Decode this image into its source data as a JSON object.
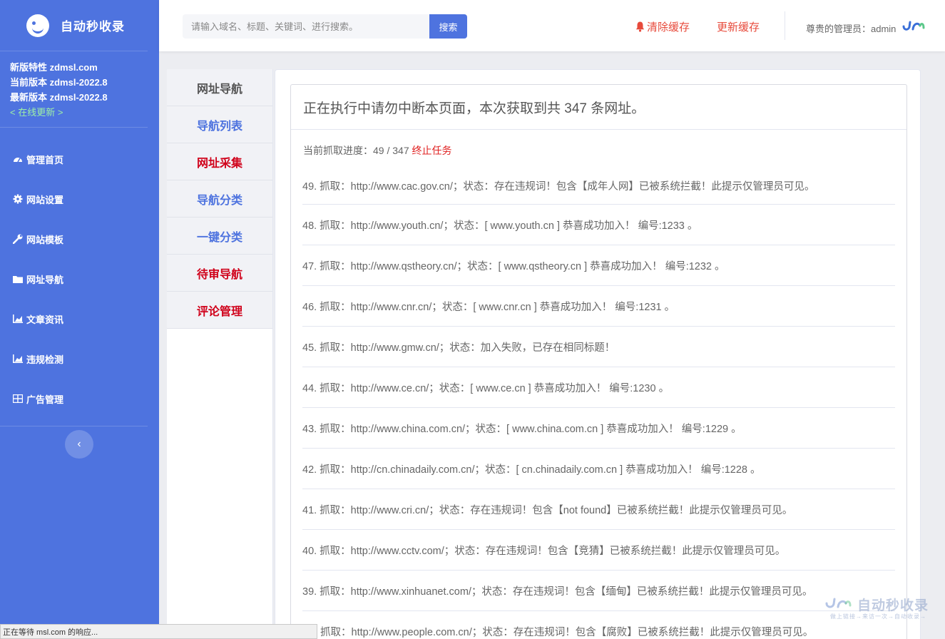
{
  "brand": {
    "title": "自动秒收录"
  },
  "version": {
    "line1": "新版特性 zdmsl.com",
    "line2": "当前版本 zdmsl-2022.8",
    "line3": "最新版本 zdmsl-2022.8",
    "update": "< 在线更新 >"
  },
  "sidebar": {
    "items": [
      {
        "label": "管理首页",
        "icon": "dashboard-icon"
      },
      {
        "label": "网站设置",
        "icon": "gear-icon"
      },
      {
        "label": "网站模板",
        "icon": "wrench-icon"
      },
      {
        "label": "网址导航",
        "icon": "folder-icon"
      },
      {
        "label": "文章资讯",
        "icon": "chart-icon"
      },
      {
        "label": "违规检测",
        "icon": "chart-icon"
      },
      {
        "label": "广告管理",
        "icon": "grid-icon"
      }
    ],
    "toggle": "‹"
  },
  "topbar": {
    "search_placeholder": "请输入域名、标题、关键词、进行搜索。",
    "search_button": "搜索",
    "clear_cache": "清除缓存",
    "update_cache": "更新缓存",
    "admin": "尊贵的管理员：admin"
  },
  "submenu": [
    {
      "label": "网址导航",
      "color": "gray"
    },
    {
      "label": "导航列表",
      "color": "blue"
    },
    {
      "label": "网址采集",
      "color": "red"
    },
    {
      "label": "导航分类",
      "color": "blue"
    },
    {
      "label": "一键分类",
      "color": "blue"
    },
    {
      "label": "待审导航",
      "color": "red"
    },
    {
      "label": "评论管理",
      "color": "red"
    }
  ],
  "panel": {
    "heading": "正在执行中请勿中断本页面，本次获取到共 347 条网址。",
    "progress_label": "当前抓取进度：",
    "progress_value": "49 / 347",
    "progress_current": 49,
    "progress_total": 347,
    "stop": "终止任务"
  },
  "log": [
    "49. 抓取：http://www.cac.gov.cn/；状态：存在违规词！包含【成年人网】已被系统拦截！此提示仅管理员可见。",
    "48. 抓取：http://www.youth.cn/；状态：[ www.youth.cn ] 恭喜成功加入！ 编号:1233 。",
    "47. 抓取：http://www.qstheory.cn/；状态：[ www.qstheory.cn ] 恭喜成功加入！ 编号:1232 。",
    "46. 抓取：http://www.cnr.cn/；状态：[ www.cnr.cn ] 恭喜成功加入！ 编号:1231 。",
    "45. 抓取：http://www.gmw.cn/；状态：加入失败，已存在相同标题！",
    "44. 抓取：http://www.ce.cn/；状态：[ www.ce.cn ] 恭喜成功加入！ 编号:1230 。",
    "43. 抓取：http://www.china.com.cn/；状态：[ www.china.com.cn ] 恭喜成功加入！ 编号:1229 。",
    "42. 抓取：http://cn.chinadaily.com.cn/；状态：[ cn.chinadaily.com.cn ] 恭喜成功加入！ 编号:1228 。",
    "41. 抓取：http://www.cri.cn/；状态：存在违规词！包含【not found】已被系统拦截！此提示仅管理员可见。",
    "40. 抓取：http://www.cctv.com/；状态：存在违规词！包含【竞猜】已被系统拦截！此提示仅管理员可见。",
    "39. 抓取：http://www.xinhuanet.com/；状态：存在违规词！包含【缅甸】已被系统拦截！此提示仅管理员可见。",
    "抓取：http://www.people.com.cn/；状态：存在违规词！包含【腐败】已被系统拦截！此提示仅管理员可见。"
  ],
  "statusbar": "正在等待 msl.com 的响应...",
  "watermark": {
    "title": "自动秒收录",
    "subtitle": "做上链接→来访一次→自动收录→"
  },
  "colors": {
    "primary": "#4e73df",
    "danger": "#e74a3b",
    "success_text": "#9ef0a6"
  }
}
